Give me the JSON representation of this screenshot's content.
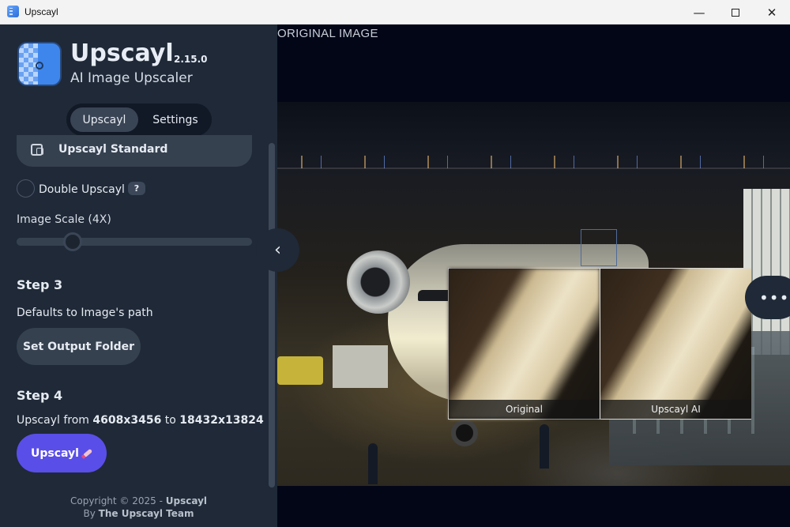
{
  "window": {
    "title": "Upscayl",
    "controls": {
      "minimize": "—",
      "maximize": "",
      "close": "✕"
    }
  },
  "sidebar": {
    "app_name": "Upscayl",
    "version": "2.15.0",
    "tagline": "AI Image Upscaler",
    "tabs": [
      {
        "label": "Upscayl",
        "active": true
      },
      {
        "label": "Settings",
        "active": false
      }
    ],
    "model": {
      "label": "Upscayl Standard"
    },
    "double_upscayl": {
      "label": "Double Upscayl",
      "help": "?",
      "checked": false
    },
    "image_scale": {
      "label": "Image Scale (4X)",
      "value_fraction": 0.2
    },
    "step3": {
      "title": "Step 3",
      "description": "Defaults to Image's path",
      "button": "Set Output Folder"
    },
    "step4": {
      "title": "Step 4",
      "prefix": "Upscayl from ",
      "from_size": "4608x3456",
      "mid": " to ",
      "to_size": "18432x13824",
      "button": "Upscayl"
    },
    "footer": {
      "copyright_prefix": "Copyright © 2025 - ",
      "copyright_name": "Upscayl",
      "by_prefix": "By ",
      "by_name": "The Upscayl Team"
    }
  },
  "main": {
    "image_label": "ORIGINAL IMAGE",
    "compare": {
      "left_caption": "Original",
      "right_caption": "Upscayl AI"
    },
    "collapse_icon": "‹",
    "more_icon": "•••"
  },
  "colors": {
    "sidebar_bg": "#1f2937",
    "main_bg": "#020617",
    "primary_button": "#5a4ee8",
    "secondary_button": "#364150"
  }
}
